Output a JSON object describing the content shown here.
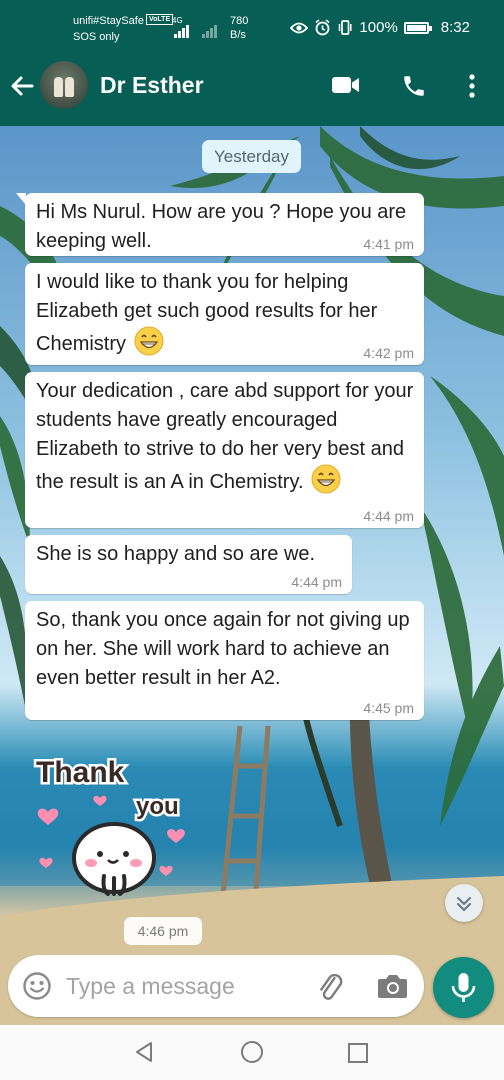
{
  "status_bar": {
    "carrier": "unifi#StaySafe",
    "network_badge": "VoLTE",
    "sos": "SOS only",
    "network_type": "4G",
    "speed_value": "780",
    "speed_unit": "B/s",
    "battery": "100%",
    "time": "8:32"
  },
  "header": {
    "contact_name": "Dr Esther",
    "icons": [
      "back-arrow-icon",
      "video-call-icon",
      "phone-icon",
      "more-vert-icon"
    ]
  },
  "chat": {
    "date_label": "Yesterday",
    "messages": [
      {
        "text": "Hi Ms Nurul. How are you ? Hope you are keeping well.",
        "time": "4:41 pm"
      },
      {
        "text": "I would like to thank you for helping Elizabeth get such good results for her Chemistry",
        "emoji": "grinning-face",
        "time": "4:42 pm"
      },
      {
        "text": "Your dedication , care abd support for your students have greatly encouraged Elizabeth to strive to do her very best and the result is an A in Chemistry.",
        "emoji": "grinning-face",
        "time": "4:44 pm"
      },
      {
        "text": "She is so happy and so are we.",
        "time": "4:44 pm"
      },
      {
        "text": "So, thank you once again for not giving up on her. She will work hard to achieve an even better result in her A2.",
        "time": "4:45 pm"
      }
    ],
    "sticker": {
      "line1": "Thank",
      "line2": "you",
      "time": "4:46 pm"
    }
  },
  "input": {
    "placeholder": "Type a message"
  },
  "colors": {
    "header": "#075e54",
    "mic_button": "#128c7e",
    "bubble": "#ffffff",
    "date_chip": "#e1f3fb"
  }
}
